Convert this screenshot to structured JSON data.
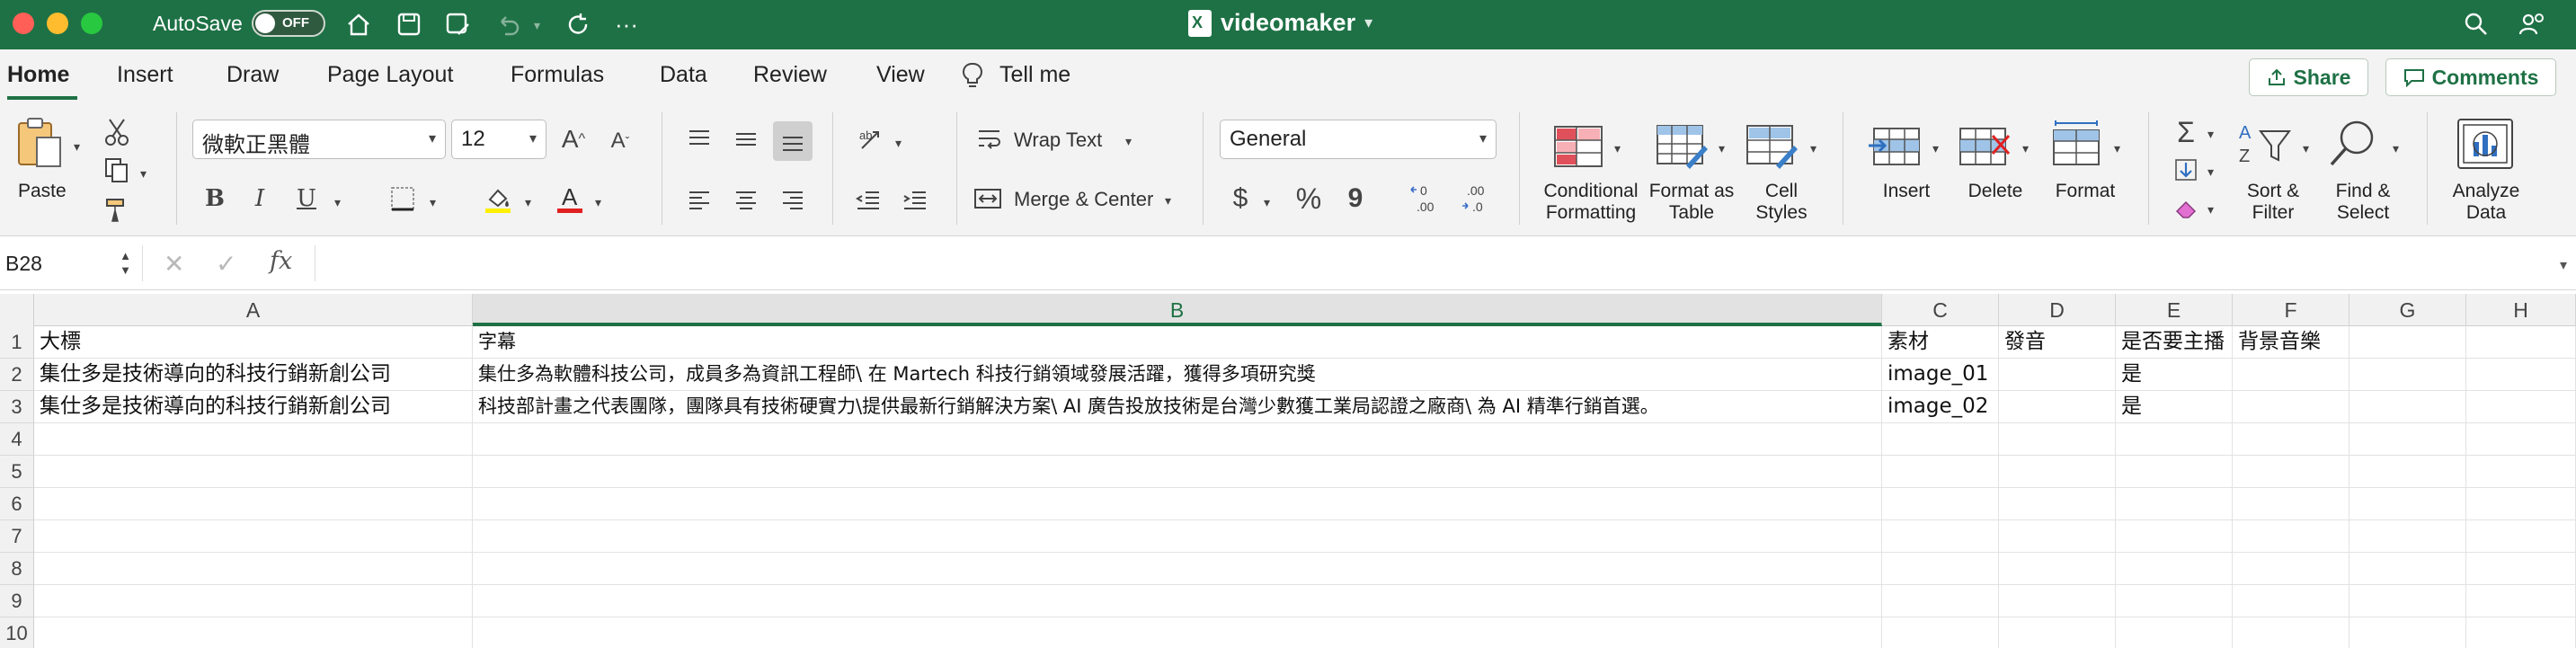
{
  "titlebar": {
    "autosave_label": "AutoSave",
    "autosave_state": "OFF",
    "doc_title": "videomaker"
  },
  "menu": {
    "tabs": [
      "Home",
      "Insert",
      "Draw",
      "Page Layout",
      "Formulas",
      "Data",
      "Review",
      "View",
      "Tell me"
    ],
    "active_tab": "Home",
    "share_label": "Share",
    "comments_label": "Comments"
  },
  "ribbon": {
    "paste_label": "Paste",
    "font_name": "微軟正黑體",
    "font_size": "12",
    "bold": "B",
    "italic": "I",
    "underline": "U",
    "wrap_text_label": "Wrap Text",
    "merge_center_label": "Merge & Center",
    "number_format": "General",
    "currency_symbol": "$",
    "percent_symbol": "%",
    "comma_symbol": "9",
    "conditional_formatting_label": "Conditional Formatting",
    "format_as_table_label": "Format as Table",
    "cell_styles_label": "Cell Styles",
    "insert_label": "Insert",
    "delete_label": "Delete",
    "format_label": "Format",
    "sort_filter_label": "Sort & Filter",
    "find_select_label": "Find & Select",
    "analyze_data_label": "Analyze Data"
  },
  "formula_bar": {
    "name_box": "B28",
    "fx_label": "fx",
    "formula": ""
  },
  "sheet": {
    "selected_column": "B",
    "columns": [
      "A",
      "B",
      "C",
      "D",
      "E",
      "F",
      "G",
      "H"
    ],
    "row_numbers": [
      "1",
      "2",
      "3",
      "4",
      "5",
      "6",
      "7",
      "8",
      "9",
      "10"
    ],
    "rows": [
      [
        "大標",
        "字幕",
        "素材",
        "發音",
        "是否要主播",
        "背景音樂",
        "",
        ""
      ],
      [
        "集仕多是技術導向的科技行銷新創公司",
        "集仕多為軟體科技公司，成員多為資訊工程師\\ 在 Martech 科技行銷領域發展活躍，獲得多項研究獎",
        "image_01",
        "",
        "是",
        "",
        "",
        ""
      ],
      [
        "集仕多是技術導向的科技行銷新創公司",
        "科技部計畫之代表團隊，團隊具有技術硬實力\\提供最新行銷解決方案\\ AI 廣告投放技術是台灣少數獲工業局認證之廠商\\ 為 AI 精準行銷首選。",
        "image_02",
        "",
        "是",
        "",
        "",
        ""
      ],
      [
        "",
        "",
        "",
        "",
        "",
        "",
        "",
        ""
      ],
      [
        "",
        "",
        "",
        "",
        "",
        "",
        "",
        ""
      ],
      [
        "",
        "",
        "",
        "",
        "",
        "",
        "",
        ""
      ],
      [
        "",
        "",
        "",
        "",
        "",
        "",
        "",
        ""
      ],
      [
        "",
        "",
        "",
        "",
        "",
        "",
        "",
        ""
      ],
      [
        "",
        "",
        "",
        "",
        "",
        "",
        "",
        ""
      ],
      [
        "",
        "",
        "",
        "",
        "",
        "",
        "",
        ""
      ]
    ]
  }
}
